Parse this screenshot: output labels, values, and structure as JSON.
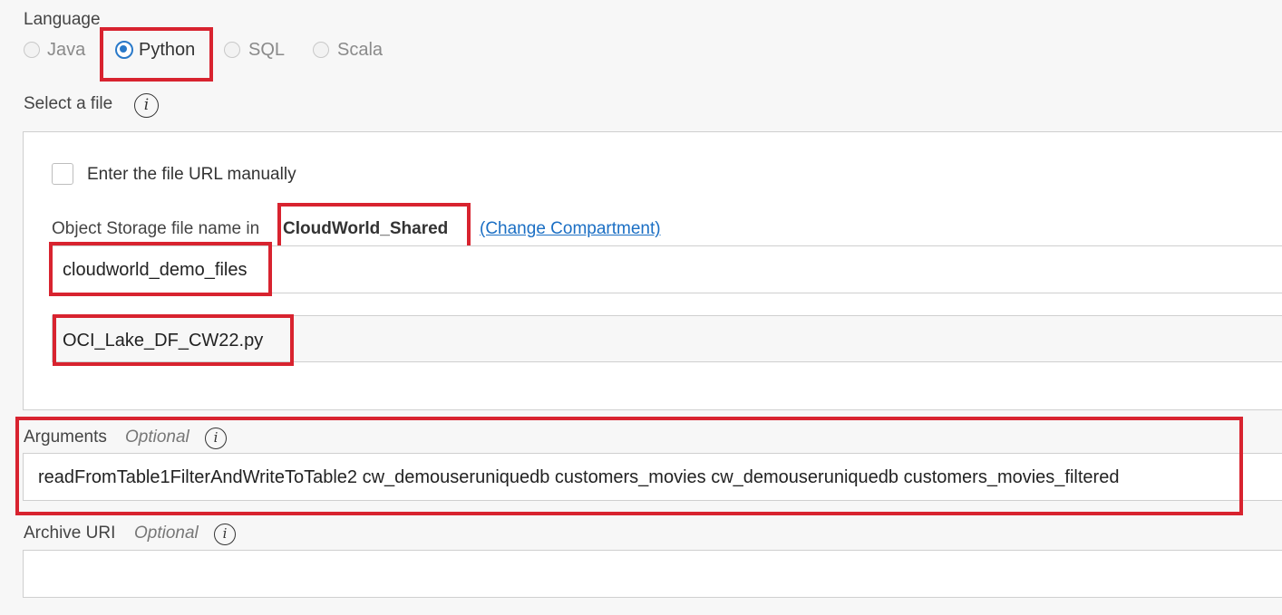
{
  "language": {
    "label": "Language",
    "options": [
      {
        "label": "Java",
        "selected": false
      },
      {
        "label": "Python",
        "selected": true
      },
      {
        "label": "SQL",
        "selected": false
      },
      {
        "label": "Scala",
        "selected": false
      }
    ]
  },
  "select_file": {
    "label": "Select a file",
    "info_icon": "info-icon",
    "manual_url_checkbox": {
      "label": "Enter the file URL manually",
      "checked": false
    },
    "object_storage_label": "Object Storage file name in",
    "compartment": "CloudWorld_Shared",
    "change_compartment_link": "(Change Compartment)",
    "bucket": "cloudworld_demo_files",
    "file_name": "OCI_Lake_DF_CW22.py"
  },
  "arguments": {
    "label": "Arguments",
    "optional": "Optional",
    "value": "readFromTable1FilterAndWriteToTable2 cw_demouseruniquedb customers_movies cw_demouseruniquedb customers_movies_filtered"
  },
  "archive_uri": {
    "label": "Archive URI",
    "optional": "Optional",
    "value": ""
  },
  "colors": {
    "accent": "#2979c9",
    "highlight": "#d8232f",
    "link": "#1b6fc4"
  }
}
